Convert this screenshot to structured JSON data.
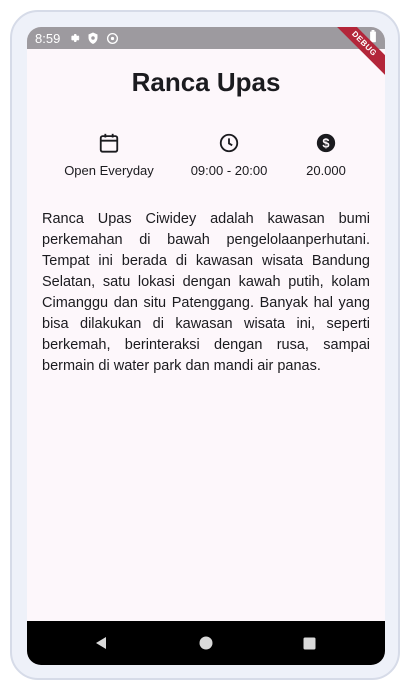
{
  "status_bar": {
    "time": "8:59",
    "left_icons": [
      "settings-icon",
      "shield-icon",
      "sync-icon"
    ],
    "right_icons": [
      "wifi-icon",
      "battery-icon"
    ],
    "debug_banner": "DEBUG",
    "background": "#9d9a9f"
  },
  "header": {
    "title": "Ranca Upas"
  },
  "info": [
    {
      "icon": "calendar-icon",
      "label": "Open Everyday"
    },
    {
      "icon": "clock-icon",
      "label": "09:00 - 20:00"
    },
    {
      "icon": "dollar-icon",
      "label": "20.000"
    }
  ],
  "description": "Ranca Upas Ciwidey adalah kawasan bumi perkemahan di bawah pengelolaanperhutani. Tempat ini berada di kawasan wisata Bandung Selatan, satu lokasi dengan kawah putih, kolam Cimanggu dan situ Patenggang. Banyak hal yang bisa dilakukan di kawasan wisata ini, seperti berkemah, berinteraksi dengan rusa, sampai bermain di water park dan mandi air panas.",
  "nav_bar": {
    "buttons": [
      "back-icon",
      "home-icon",
      "recents-icon"
    ]
  },
  "colors": {
    "screen_background": "#fdf7fb",
    "text": "#1b1b1f",
    "debug_ribbon": "#b3263a"
  }
}
